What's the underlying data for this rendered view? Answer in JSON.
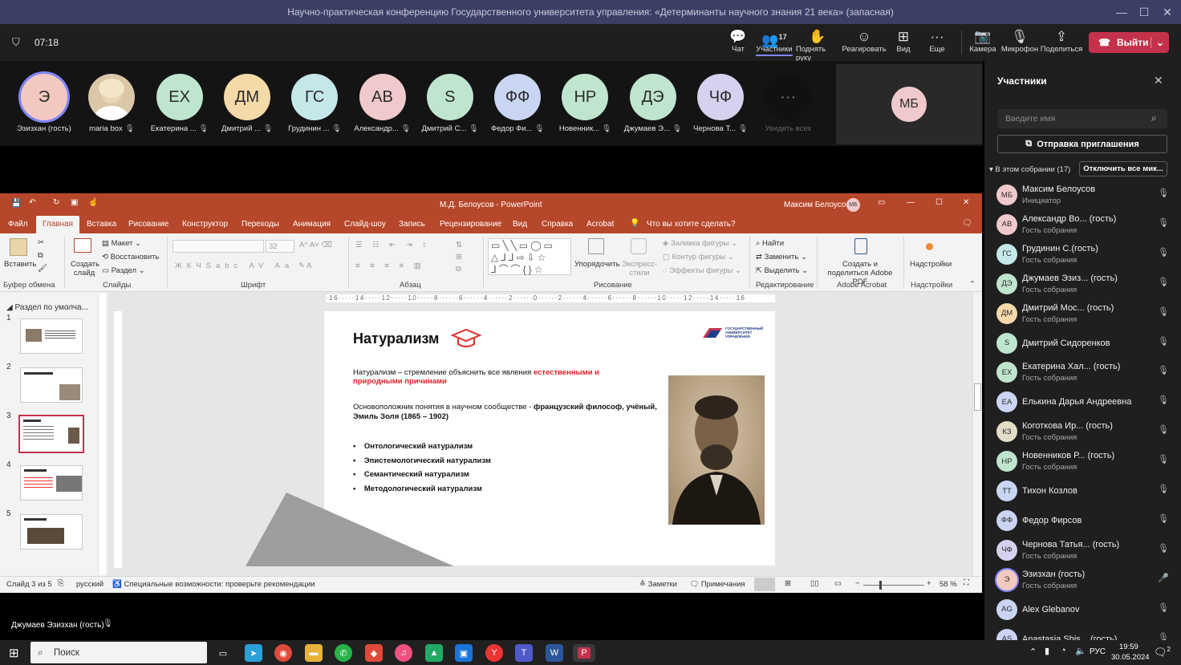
{
  "window": {
    "title": "Научно-практическая конференцию Государственного университета управления: «Детерминанты научного знания 21 века» (запасная)"
  },
  "toolbar": {
    "timer": "07:18",
    "chat": "Чат",
    "participants_count": "17",
    "participants": "Участники",
    "raise_hand": "Поднять руку",
    "react": "Реагировать",
    "view": "Вид",
    "more": "Еще",
    "camera": "Камера",
    "mic": "Микрофон",
    "share": "Поделиться",
    "leave": "Выйти"
  },
  "gallery": [
    {
      "initials": "Э",
      "name": "Эзизхан (гость)",
      "color": "#f2c8c1"
    },
    {
      "initials": "",
      "name": "maria box",
      "color": "#d9c7a8"
    },
    {
      "initials": "ЕХ",
      "name": "Екатерина ...",
      "color": "#bfe5cf"
    },
    {
      "initials": "ДМ",
      "name": "Дмитрий ...",
      "color": "#f6d9a8"
    },
    {
      "initials": "ГС",
      "name": "Грудинин ...",
      "color": "#c4e7e9"
    },
    {
      "initials": "АВ",
      "name": "Александр...",
      "color": "#f0c9cc"
    },
    {
      "initials": "S",
      "name": "Дмитрий С...",
      "color": "#bfe5cf"
    },
    {
      "initials": "ФФ",
      "name": "Федор Фи...",
      "color": "#c9d5f2"
    },
    {
      "initials": "НР",
      "name": "Новенник...",
      "color": "#bfe5cf"
    },
    {
      "initials": "ДЭ",
      "name": "Джумаев Э...",
      "color": "#bfe5cf"
    },
    {
      "initials": "ЧФ",
      "name": "Чернова Т...",
      "color": "#d7d0ee"
    }
  ],
  "gallery_more": "Увидеть всех",
  "mb_tile": "МБ",
  "ppt": {
    "doc_title": "М.Д. Белоусов  -  PowerPoint",
    "user": "Максим Белоусов",
    "user_initials": "МБ",
    "tabs": [
      "Файл",
      "Главная",
      "Вставка",
      "Рисование",
      "Конструктор",
      "Переходы",
      "Анимация",
      "Слайд-шоу",
      "Запись",
      "Рецензирование",
      "Вид",
      "Справка",
      "Acrobat"
    ],
    "search": "Что вы хотите сделать?",
    "ribbon": {
      "paste": "Вставить",
      "clipboard": "Буфер обмена",
      "new_slide": "Создать слайд",
      "layout": "Макет",
      "reset": "Восстановить",
      "section": "Раздел",
      "slides": "Слайды",
      "font_size": "32",
      "font": "Шрифт",
      "paragraph": "Абзац",
      "arrange": "Упорядочить",
      "quick_styles": "Экспресс-стили",
      "fill": "Заливка фигуры",
      "outline": "Контур фигуры",
      "effects": "Эффекты фигуры",
      "drawing": "Рисование",
      "find": "Найти",
      "replace": "Заменить",
      "select": "Выделить",
      "editing": "Редактирование",
      "acrobat_btn": "Создать и поделиться Adobe PDF",
      "acrobat": "Adobe Acrobat",
      "addins_btn": "Надстройки",
      "addins": "Надстройки"
    },
    "section_name": "Раздел по умолча...",
    "slide_numbers": [
      "1",
      "2",
      "3",
      "4",
      "5"
    ],
    "slide": {
      "title": "Натурализм",
      "logo_text": "ГОСУДАРСТВЕННЫЙ УНИВЕРСИТЕТ УПРАВЛЕНИЯ",
      "p1_plain": "Натурализм – стремление объяснить все явления ",
      "p1_red": "естественными и природными причинами",
      "p2_plain": "Основоположник понятия в научном сообществе - ",
      "p2_bold": "французский философ, учёный, Эмиль Золя (1865 – 1902)",
      "bullets": [
        "Онтологический натурализм",
        "Эпистемологический натурализм",
        "Семантический натурализм",
        "Методологический натурализм"
      ]
    },
    "status": {
      "slide": "Слайд 3 из 5",
      "lang": "русский",
      "access": "Специальные возможности: проверьте рекомендации",
      "notes": "Заметки",
      "comments": "Примечания",
      "zoom": "58 %"
    }
  },
  "panel": {
    "title": "Участники",
    "search_placeholder": "Введите имя",
    "invite": "Отправка приглашения",
    "section": "В этом собрании (17)",
    "mute_all": "Отключить все мик...",
    "people": [
      {
        "initials": "МБ",
        "name": "Максим Белоусов",
        "role": "Инициатор",
        "color": "#f0c9cc"
      },
      {
        "initials": "АВ",
        "name": "Александр Во... (гость)",
        "role": "Гость собрания",
        "color": "#f0c9cc"
      },
      {
        "initials": "ГС",
        "name": "Грудинин С.(гость)",
        "role": "Гость собрания",
        "color": "#c4e7e9"
      },
      {
        "initials": "ДЭ",
        "name": "Джумаев Эзиз... (гость)",
        "role": "Гость собрания",
        "color": "#bfe5cf"
      },
      {
        "initials": "ДМ",
        "name": "Дмитрий Мос... (гость)",
        "role": "Гость собрания",
        "color": "#f6d9a8"
      },
      {
        "initials": "S",
        "name": "Дмитрий Сидоренков",
        "role": "",
        "color": "#bfe5cf"
      },
      {
        "initials": "ЕХ",
        "name": "Екатерина Хал... (гость)",
        "role": "Гость собрания",
        "color": "#bfe5cf"
      },
      {
        "initials": "ЕА",
        "name": "Елькина Дарья Андреевна",
        "role": "",
        "color": "#c9d5f2"
      },
      {
        "initials": "КЗ",
        "name": "Коготкова Ир... (гость)",
        "role": "Гость собрания",
        "color": "#e2ddc7"
      },
      {
        "initials": "НР",
        "name": "Новенников Р... (гость)",
        "role": "Гость собрания",
        "color": "#bfe5cf"
      },
      {
        "initials": "ТТ",
        "name": "Тихон Козлов",
        "role": "",
        "color": "#c9d5f2"
      },
      {
        "initials": "ФФ",
        "name": "Федор Фирсов",
        "role": "",
        "color": "#c9d5f2"
      },
      {
        "initials": "ЧФ",
        "name": "Чернова Татья... (гость)",
        "role": "Гость собрания",
        "color": "#d7d0ee"
      },
      {
        "initials": "Э",
        "name": "Эзизхан (гость)",
        "role": "Гость собрания",
        "color": "#f2c8c1"
      },
      {
        "initials": "AG",
        "name": "Alex Glebanov",
        "role": "",
        "color": "#c9d5f2"
      },
      {
        "initials": "AS",
        "name": "Anastasia Shis... (гость)",
        "role": "",
        "color": "#c9d5f2"
      }
    ]
  },
  "speaker": "Джумаев Эзизхан (гость)",
  "taskbar": {
    "search": "Поиск",
    "lang": "РУС",
    "time": "19:59",
    "date": "30.05.2024",
    "notif": "2"
  }
}
